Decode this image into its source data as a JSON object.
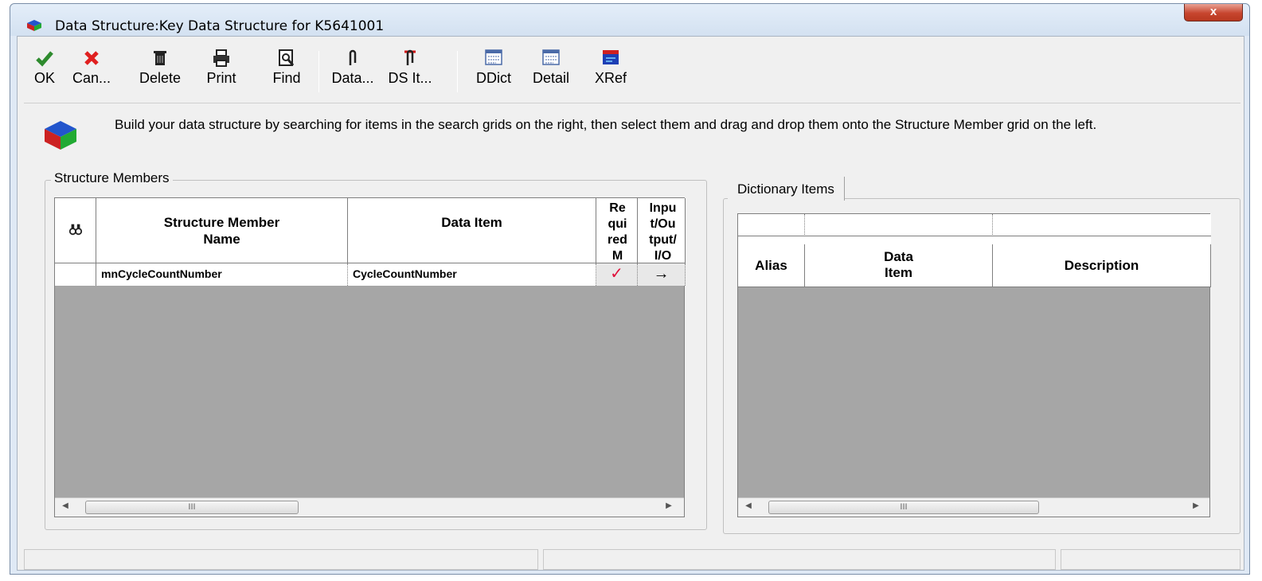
{
  "window": {
    "title": "Data Structure:Key Data Structure for K5641001",
    "close_label": "x"
  },
  "toolbar": {
    "ok": "OK",
    "cancel": "Can...",
    "delete": "Delete",
    "print": "Print",
    "find": "Find",
    "data": "Data...",
    "ds_item": "DS It...",
    "ddict": "DDict",
    "detail": "Detail",
    "xref": "XRef"
  },
  "instruction": "Build your data structure by searching for items in the search grids on the right, then select them and drag and drop them onto the Structure Member grid on the left.",
  "structure_members": {
    "group_title": "Structure Members",
    "columns": [
      "Structure Member Name",
      "Data Item",
      "Re qui red M",
      "Inpu t/Ou tput/ I/O"
    ],
    "rows": [
      {
        "member_name": "mnCycleCountNumber",
        "data_item": "CycleCountNumber",
        "required": "✓",
        "io": "→"
      }
    ],
    "scroll_thumb": "III"
  },
  "dictionary_items": {
    "tab_label": "Dictionary Items",
    "columns": [
      "Alias",
      "Data Item",
      "Description"
    ],
    "scroll_thumb": "III"
  },
  "colors": {
    "window_bg": "#f0f0f0",
    "grid_empty": "#a6a6a6",
    "close_red": "#c7462f",
    "ok_green": "#2e8b2e",
    "cancel_red": "#e02020"
  }
}
